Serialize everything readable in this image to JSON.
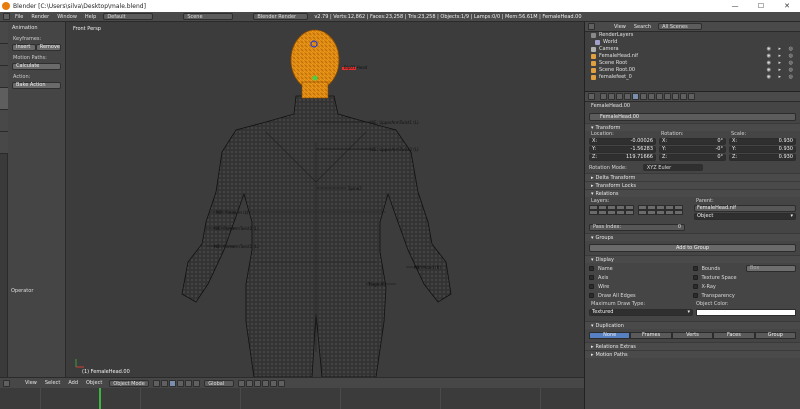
{
  "window": {
    "title": "Blender [C:\\Users\\silva\\Desktop\\male.blend]",
    "minimize": "—",
    "maximize": "☐",
    "close": "✕"
  },
  "infobar": {
    "menus": [
      "File",
      "Render",
      "Window",
      "Help"
    ],
    "layout": "Default",
    "scene": "Scene",
    "engine": "Blender Render",
    "stats": "v2.79 | Verts:12,862 | Faces:23,258 | Tris:23,258 | Objects:1/9 | Lamps:0/0 | Mem:56.61M | FemaleHead.00"
  },
  "tool_shelf": {
    "header": "Animation",
    "keyframes_label": "Keyframes:",
    "insert": "Insert",
    "remove": "Remove",
    "motion_label": "Motion Paths:",
    "calculate": "Calculate",
    "action_label": "Action:",
    "bake": "Bake Action",
    "operator": "Operator"
  },
  "viewport": {
    "title": "Front Persp",
    "object_label": "(1) FemaleHead.00",
    "bone_labels": [
      "Bip01 Head",
      "NIE: UpperArmTwist1 (L)",
      "NIE: UpperArmTwist2 (L)",
      "Spine2",
      "NIE: Forearm (L)",
      "NIE: ForearmTwist2 (L)",
      "NIE: ForearmTwist1 (L)",
      "NIE: Hand (R)",
      "Thigh (R)"
    ]
  },
  "viewport_header": {
    "menus": [
      "View",
      "Select",
      "Add",
      "Object"
    ],
    "mode": "Object Mode",
    "pivot": "Global"
  },
  "outliner": {
    "view": "View",
    "search": "Search",
    "filter": "All Scenes",
    "rows": [
      {
        "label": "RenderLayers",
        "color": "#8a8a8a"
      },
      {
        "label": "World",
        "color": "#a0a0c8"
      },
      {
        "label": "Camera",
        "color": "#b0b0b0"
      },
      {
        "label": "FemaleHead.nif",
        "color": "#e0a040"
      },
      {
        "label": "Scene Root",
        "color": "#e0a040"
      },
      {
        "label": "Scene Root.00",
        "color": "#e0a040"
      },
      {
        "label": "femalefeet_0",
        "color": "#e0a040"
      }
    ]
  },
  "properties": {
    "breadcrumb": "FemaleHead.00",
    "name": "FemaleHead.00",
    "transform": "Transform",
    "location_label": "Location:",
    "rotation_label": "Rotation:",
    "scale_label": "Scale:",
    "location": [
      [
        "X:",
        "-0.00026"
      ],
      [
        "Y:",
        "-1.56283"
      ],
      [
        "Z:",
        "119.71666"
      ]
    ],
    "rotation": [
      [
        "X:",
        "0°"
      ],
      [
        "Y:",
        "-0°"
      ],
      [
        "Z:",
        "0°"
      ]
    ],
    "scale": [
      [
        "X:",
        "0.930"
      ],
      [
        "Y:",
        "0.930"
      ],
      [
        "Z:",
        "0.930"
      ]
    ],
    "rotation_mode_label": "Rotation Mode:",
    "rotation_mode": "XYZ Euler",
    "delta": "Delta Transform",
    "locks": "Transform Locks",
    "relations": "Relations",
    "layers_label": "Layers:",
    "parent_label": "Parent:",
    "parent": "FemaleHead.nif",
    "parent_type": "Object",
    "pass_index_label": "Pass Index:",
    "pass_index": "0",
    "groups": "Groups",
    "add_to_group": "Add to Group",
    "display": "Display",
    "display_checks": [
      "Name",
      "Bounds",
      "Axis",
      "Texture Space",
      "Wire",
      "X-Ray",
      "Draw All Edges",
      "Transparency"
    ],
    "bounds_type": "Box",
    "max_draw_label": "Maximum Draw Type:",
    "max_draw": "Textured",
    "object_color_label": "Object Color:",
    "duplication": "Duplication",
    "dup_options": [
      "None",
      "Frames",
      "Verts",
      "Faces",
      "Group"
    ],
    "relations_extras": "Relations Extras",
    "motion_paths": "Motion Paths"
  }
}
